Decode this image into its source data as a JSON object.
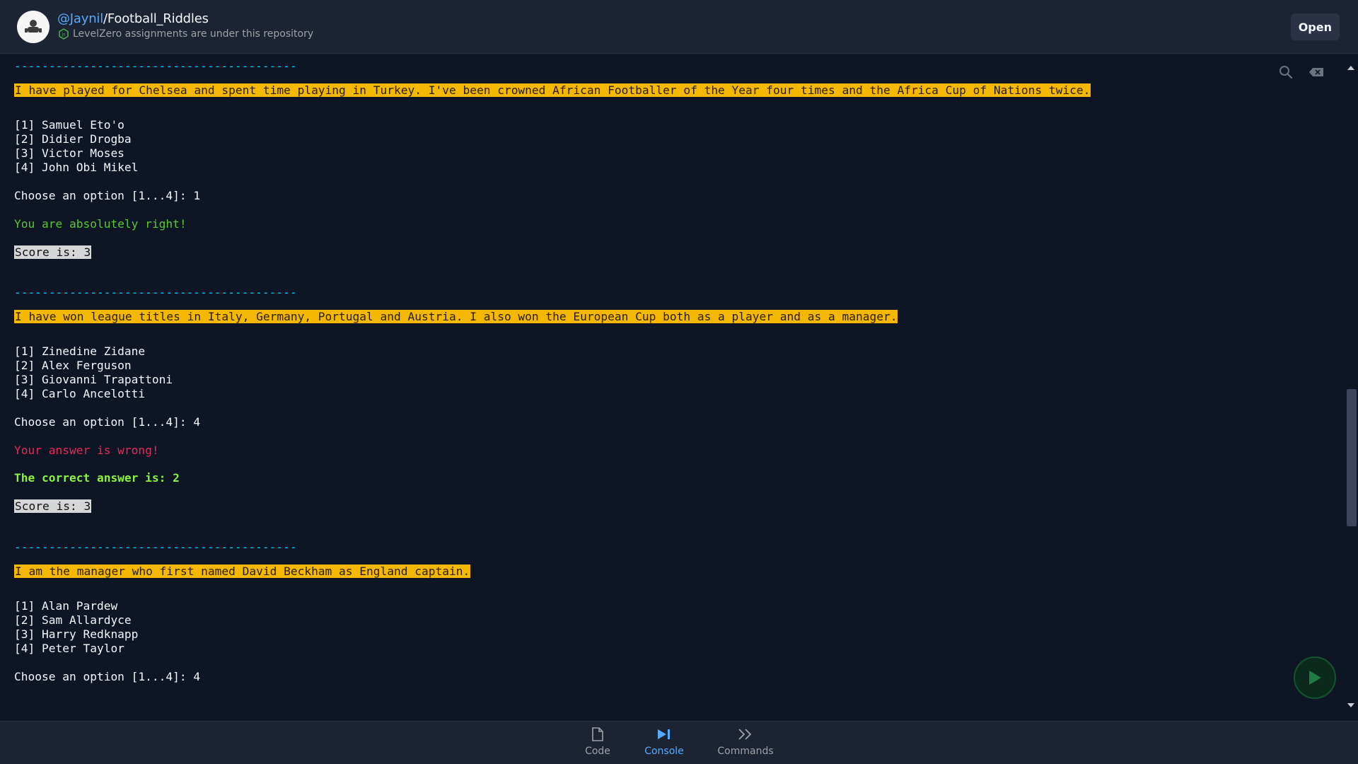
{
  "header": {
    "repo_user": "@Jaynil",
    "repo_slash": "/",
    "repo_name": "Football_Riddles",
    "description": "LevelZero assignments are under this repository",
    "open_label": "Open"
  },
  "console": {
    "lines": [
      {
        "text": "-----------------------------------------",
        "style": "sep"
      },
      {
        "text": "I have played for Chelsea and spent time playing in Turkey. I've been crowned African Footballer of the Year four times and the Africa Cup of Nations twice.",
        "style": "question"
      },
      {
        "text": "[1] Samuel Eto'o",
        "style": "plain"
      },
      {
        "text": "[2] Didier Drogba",
        "style": "plain"
      },
      {
        "text": "[3] Victor Moses",
        "style": "plain"
      },
      {
        "text": "[4] John Obi Mikel",
        "style": "plain"
      },
      {
        "text": "Choose an option [1...4]: 1",
        "style": "plain"
      },
      {
        "text": "You are absolutely right!",
        "style": "right"
      },
      {
        "text": "Score is: 3",
        "style": "score"
      },
      {
        "text": "-----------------------------------------",
        "style": "sep"
      },
      {
        "text": "I have won league titles in Italy, Germany, Portugal and Austria. I also won the European Cup both as a player and as a manager.",
        "style": "question"
      },
      {
        "text": "[1] Zinedine Zidane",
        "style": "plain"
      },
      {
        "text": "[2] Alex Ferguson",
        "style": "plain"
      },
      {
        "text": "[3] Giovanni Trapattoni",
        "style": "plain"
      },
      {
        "text": "[4] Carlo Ancelotti",
        "style": "plain"
      },
      {
        "text": "Choose an option [1...4]: 4",
        "style": "plain"
      },
      {
        "text": "Your answer is wrong!",
        "style": "wrong"
      },
      {
        "text": "The correct answer is: 2",
        "style": "correct"
      },
      {
        "text": "Score is: 3",
        "style": "score"
      },
      {
        "text": "-----------------------------------------",
        "style": "sep"
      },
      {
        "text": "I am the manager who first named David Beckham as England captain.",
        "style": "question"
      },
      {
        "text": "[1] Alan Pardew",
        "style": "plain"
      },
      {
        "text": "[2] Sam Allardyce",
        "style": "plain"
      },
      {
        "text": "[3] Harry Redknapp",
        "style": "plain"
      },
      {
        "text": "[4] Peter Taylor",
        "style": "plain"
      },
      {
        "text": "Choose an option [1...4]: 4",
        "style": "plain"
      }
    ]
  },
  "icons": {
    "search": "search-icon",
    "clear": "clear-console-icon",
    "run": "run-icon"
  },
  "bottom_nav": {
    "items": [
      {
        "label": "Code",
        "icon": "file-icon",
        "active": false
      },
      {
        "label": "Console",
        "icon": "console-icon",
        "active": true
      },
      {
        "label": "Commands",
        "icon": "commands-icon",
        "active": false
      }
    ]
  },
  "colors": {
    "background": "#0e1525",
    "header": "#1c2333",
    "question_highlight": "#f5b800",
    "separator": "#00c8ff",
    "right": "#58c833",
    "wrong": "#e52a55",
    "active_nav": "#57abff"
  }
}
